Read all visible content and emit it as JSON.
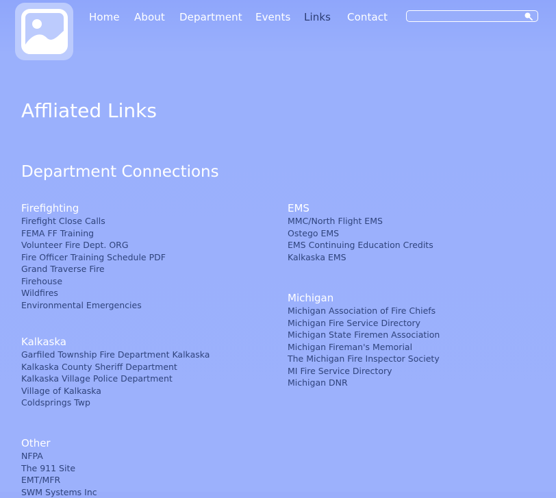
{
  "nav": {
    "items": [
      {
        "label": "Home",
        "active": false
      },
      {
        "label": "About",
        "active": false
      },
      {
        "label": "Department",
        "active": false
      },
      {
        "label": "Events",
        "active": false
      },
      {
        "label": "Links",
        "active": true
      },
      {
        "label": "Contact",
        "active": false
      }
    ]
  },
  "search": {
    "value": "",
    "placeholder": "",
    "icon": "search-icon"
  },
  "logo": {
    "icon": "image-placeholder-icon"
  },
  "page": {
    "title": "Affliated Links",
    "section_title": "Department Connections"
  },
  "groups": {
    "firefighting": {
      "heading": "Firefighting",
      "links": [
        "Firefight Close Calls",
        "FEMA FF Training",
        "Volunteer Fire Dept. ORG",
        "Fire Officer Training Schedule PDF",
        "Grand Traverse Fire",
        "Firehouse",
        "Wildfires",
        "Environmental Emergencies"
      ]
    },
    "kalkaska": {
      "heading": "Kalkaska",
      "links": [
        "Garfiled Township Fire Department Kalkaska",
        "Kalkaska County Sheriff Department",
        "Kalkaska Village Police Department",
        "Village of Kalkaska",
        "Coldsprings Twp"
      ]
    },
    "other": {
      "heading": "Other",
      "links": [
        "NFPA",
        "The 911 Site",
        "EMT/MFR",
        "SWM Systems Inc"
      ]
    },
    "ems": {
      "heading": "EMS",
      "links": [
        "MMC/North Flight EMS",
        "Ostego EMS",
        "EMS Continuing Education Credits",
        "Kalkaska EMS"
      ]
    },
    "michigan": {
      "heading": "Michigan",
      "links": [
        "Michigan Association of Fire Chiefs",
        "Michigan Fire Service Directory",
        "Michigan State Firemen Association",
        "Michigan Fireman's Memorial",
        "The Michigan Fire Inspector Society",
        "MI Fire Service Directory",
        "Michigan DNR"
      ]
    }
  },
  "colors": {
    "background": "#9aaefb",
    "text_light": "#ffffff",
    "link": "#2f437c",
    "logo_bg": "#bccbfd"
  }
}
